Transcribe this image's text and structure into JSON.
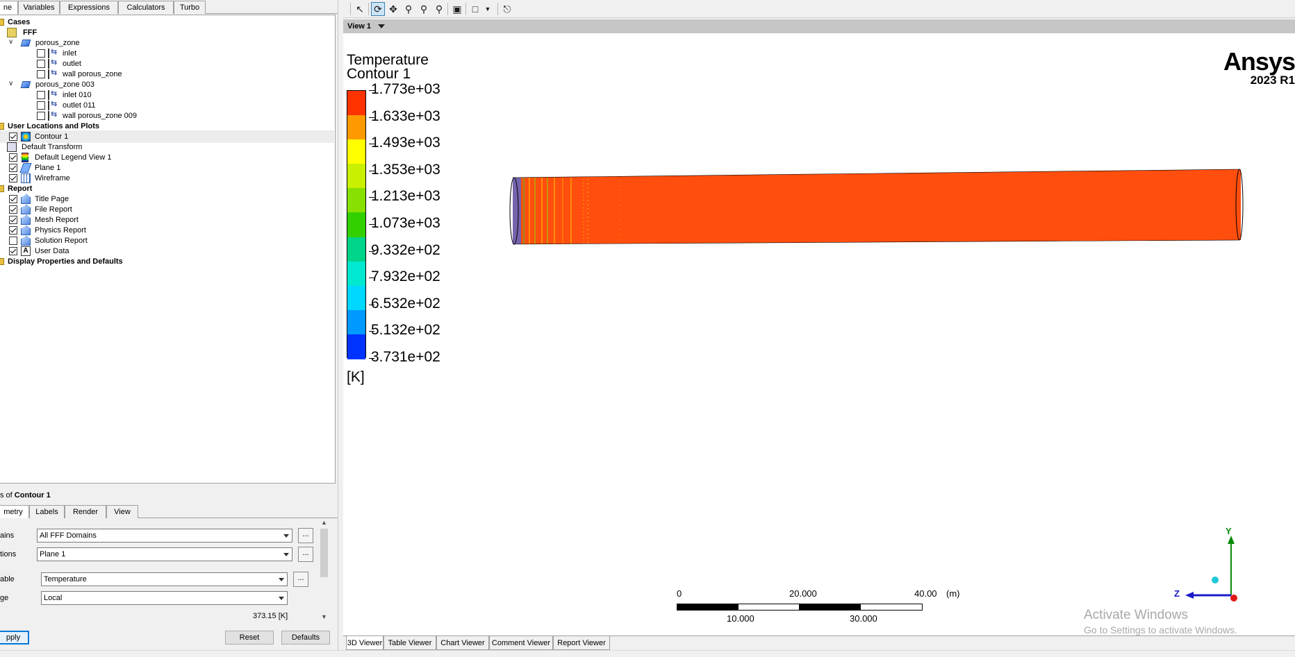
{
  "top_tabs": [
    "ne",
    "Variables",
    "Expressions",
    "Calculators",
    "Turbo"
  ],
  "tree": {
    "cases": "Cases",
    "case_name": "FFF",
    "zone1": "porous_zone",
    "zone1_children": [
      "inlet",
      "outlet",
      "wall porous_zone"
    ],
    "zone2": "porous_zone 003",
    "zone2_children": [
      "inlet 010",
      "outlet 011",
      "wall porous_zone 009"
    ],
    "user_locations": "User Locations and Plots",
    "user_items": [
      "Contour 1",
      "Default Transform",
      "Default Legend View 1",
      "Plane 1",
      "Wireframe"
    ],
    "report": "Report",
    "report_items": [
      "Title Page",
      "File Report",
      "Mesh Report",
      "Physics Report",
      "Solution Report",
      "User Data"
    ],
    "display": "Display Properties and Defaults"
  },
  "details": {
    "title_prefix": "s of ",
    "title_obj": "Contour 1",
    "tabs": [
      "metry",
      "Labels",
      "Render",
      "View"
    ],
    "domains_label": "ains",
    "domains_value": "All FFF Domains",
    "locations_label": "tions",
    "locations_value": "Plane 1",
    "variable_label": "able",
    "variable_value": "Temperature",
    "range_label": "ge",
    "range_value": "Local",
    "min_value": "373.15 [K]",
    "dots": "...",
    "apply": "pply",
    "reset": "Reset",
    "defaults": "Defaults"
  },
  "viewer": {
    "view_name": "View 1",
    "legend_title": "Temperature",
    "legend_subtitle": "Contour 1",
    "legend_values": [
      "1.773e+03",
      "1.633e+03",
      "1.493e+03",
      "1.353e+03",
      "1.213e+03",
      "1.073e+03",
      "9.332e+02",
      "7.932e+02",
      "6.532e+02",
      "5.132e+02",
      "3.731e+02"
    ],
    "legend_colors": [
      "#ff3300",
      "#ff9900",
      "#ffff00",
      "#c8f000",
      "#88e000",
      "#33d000",
      "#00d488",
      "#00e8d0",
      "#00d8ff",
      "#0099ff",
      "#0033ff"
    ],
    "legend_units": "[K]",
    "brand": "Ansys",
    "version": "2023 R1",
    "scale_top": [
      "0",
      "20.000",
      "40.00"
    ],
    "scale_unit": "(m)",
    "scale_bottom": [
      "10.000",
      "30.000"
    ],
    "axis_y": "Y",
    "axis_z": "Z",
    "watermark_title": "Activate Windows",
    "watermark_sub": "Go to Settings to activate Windows."
  },
  "bottom_tabs": [
    "3D Viewer",
    "Table Viewer",
    "Chart Viewer",
    "Comment Viewer",
    "Report Viewer"
  ],
  "toolbar_icons": [
    "select-icon",
    "rotate-icon",
    "pan-icon",
    "zoom-icon",
    "zoom-box-icon",
    "zoom-fit-icon",
    "zoom-region-icon",
    "viewport-layout-icon",
    "dropdown-icon",
    "sync-views-icon"
  ]
}
